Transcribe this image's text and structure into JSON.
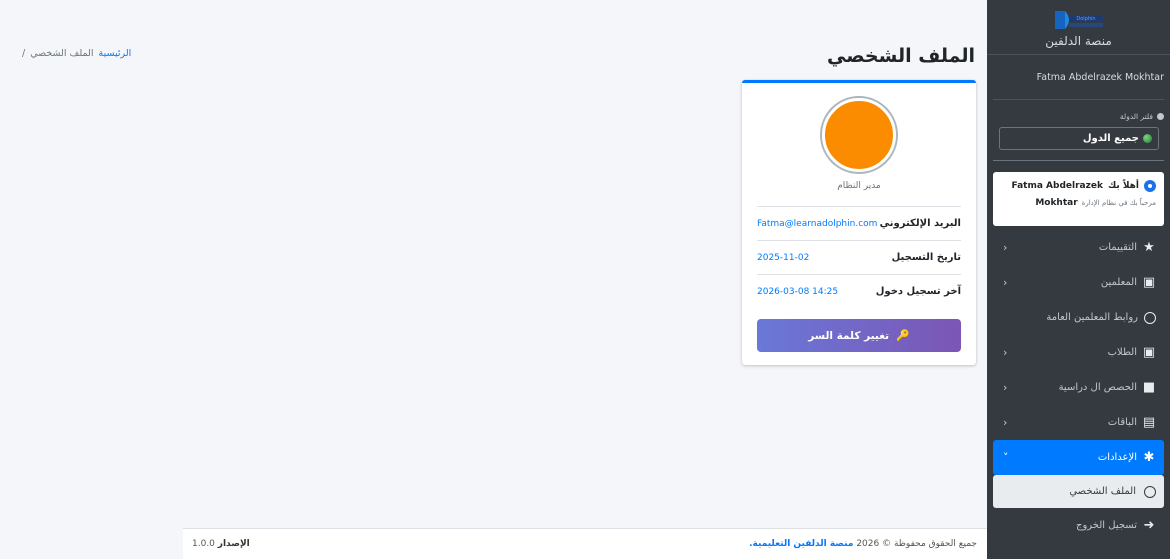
{
  "sidebar": {
    "brand_name": "منصة الدلفين",
    "logo_text": "Dolphin",
    "user_name": "Fatma Abdelrazek Mokhtar",
    "country_filter_label": "فلتر الدولة",
    "country_filter_value": "جميع الدول",
    "welcome_greeting": "أهلاً بك",
    "welcome_name_first": "Fatma Abdelrazek",
    "welcome_name_last": "Mokhtar",
    "welcome_subtitle": "مرحباً بك في نظام الإدارة",
    "items": [
      {
        "label": "التقييمات",
        "icon": "star-icon",
        "has_arrow": true
      },
      {
        "label": "المعلمين",
        "icon": "teacher-icon",
        "has_arrow": true
      },
      {
        "label": "روابط المعلمين العامة",
        "icon": "circle-icon",
        "has_arrow": false
      },
      {
        "label": "الطلاب",
        "icon": "student-icon",
        "has_arrow": true
      },
      {
        "label": "الحصص ال دراسية",
        "icon": "video-icon",
        "has_arrow": true
      },
      {
        "label": "الباقات",
        "icon": "package-icon",
        "has_arrow": true
      },
      {
        "label": "الإعدادات",
        "icon": "gear-icon",
        "has_arrow": true,
        "active": true
      }
    ],
    "sub_item": "الملف الشخصي",
    "logout": "تسجيل الخروج"
  },
  "header": {
    "title": "الملف الشخصي",
    "breadcrumb_home": "الرئيسية",
    "breadcrumb_current": "الملف الشخصي",
    "breadcrumb_sep": "/"
  },
  "profile": {
    "role": "مدير النظام",
    "rows": [
      {
        "key": "البريد الإلكتروني",
        "value": "Fatma@learnadolphin.com"
      },
      {
        "key": "تاريخ التسجيل",
        "value": "2025-11-02"
      },
      {
        "key": "آخر تسجيل دخول",
        "value": "2026-03-08 14:25"
      }
    ],
    "change_password": "تغيير كلمة السر"
  },
  "footer": {
    "copyright_prefix": "جميع الحقوق محفوظة © 2026",
    "copyright_brand": "منصة الدلفين التعليمية.",
    "version_label": "الإصدار",
    "version_value": "1.0.0"
  },
  "colors": {
    "sidebar_bg": "#343a40",
    "accent": "#007bff",
    "avatar": "#fb8c00",
    "button_gradient_start": "#6a78d8",
    "button_gradient_end": "#7b56b5"
  }
}
